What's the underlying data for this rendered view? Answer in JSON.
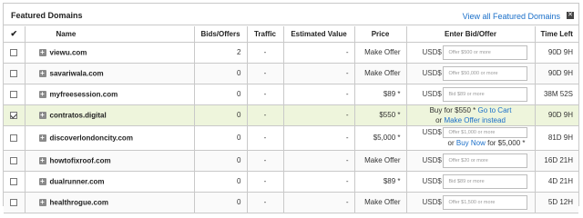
{
  "header": {
    "title": "Featured Domains",
    "view_all_label": "View all Featured Domains",
    "close_icon": "close-icon"
  },
  "columns": {
    "check": "✔",
    "name": "Name",
    "bids": "Bids/Offers",
    "traffic": "Traffic",
    "estimated": "Estimated Value",
    "price": "Price",
    "enter_bid": "Enter Bid/Offer",
    "time_left": "Time Left"
  },
  "rows": [
    {
      "name": "viewu.com",
      "bids": "2",
      "traffic": "-",
      "estimated": "-",
      "price": "Make Offer",
      "currency": "USD$",
      "placeholder": "Offer $500 or more",
      "time_left": "90D 9H",
      "checked": false
    },
    {
      "name": "savariwala.com",
      "bids": "0",
      "traffic": "-",
      "estimated": "-",
      "price": "Make Offer",
      "currency": "USD$",
      "placeholder": "Offer $50,000 or more",
      "time_left": "90D 9H",
      "checked": false
    },
    {
      "name": "myfreesession.com",
      "bids": "0",
      "traffic": "-",
      "estimated": "-",
      "price": "$89 *",
      "currency": "USD$",
      "placeholder": "Bid $89 or more",
      "time_left": "38M 52S",
      "checked": false
    },
    {
      "name": "contratos.digital",
      "bids": "0",
      "traffic": "-",
      "estimated": "-",
      "price": "$550 *",
      "buy_text": "Buy for $550 *",
      "go_to_cart": "Go to Cart",
      "or_text": "or",
      "make_offer_instead": "Make Offer instead",
      "time_left": "90D 9H",
      "checked": true
    },
    {
      "name": "discoverlondoncity.com",
      "bids": "0",
      "traffic": "-",
      "estimated": "-",
      "price": "$5,000 *",
      "currency": "USD$",
      "placeholder": "Offer $1,000 or more",
      "or_text": "or",
      "buy_now": "Buy Now",
      "buy_for": "for $5,000 *",
      "time_left": "81D 9H",
      "checked": false
    },
    {
      "name": "howtofixroof.com",
      "bids": "0",
      "traffic": "-",
      "estimated": "-",
      "price": "Make Offer",
      "currency": "USD$",
      "placeholder": "Offer $20 or more",
      "time_left": "16D 21H",
      "checked": false
    },
    {
      "name": "dualrunner.com",
      "bids": "0",
      "traffic": "-",
      "estimated": "-",
      "price": "$89 *",
      "currency": "USD$",
      "placeholder": "Bid $89 or more",
      "time_left": "4D 21H",
      "checked": false
    },
    {
      "name": "healthrogue.com",
      "bids": "0",
      "traffic": "-",
      "estimated": "-",
      "price": "Make Offer",
      "currency": "USD$",
      "placeholder": "Offer $1,500 or more",
      "time_left": "5D 12H",
      "checked": false
    }
  ],
  "colors": {
    "link": "#1a6fc9",
    "highlight_row": "#eef5dc",
    "border": "#c9c9c9"
  }
}
